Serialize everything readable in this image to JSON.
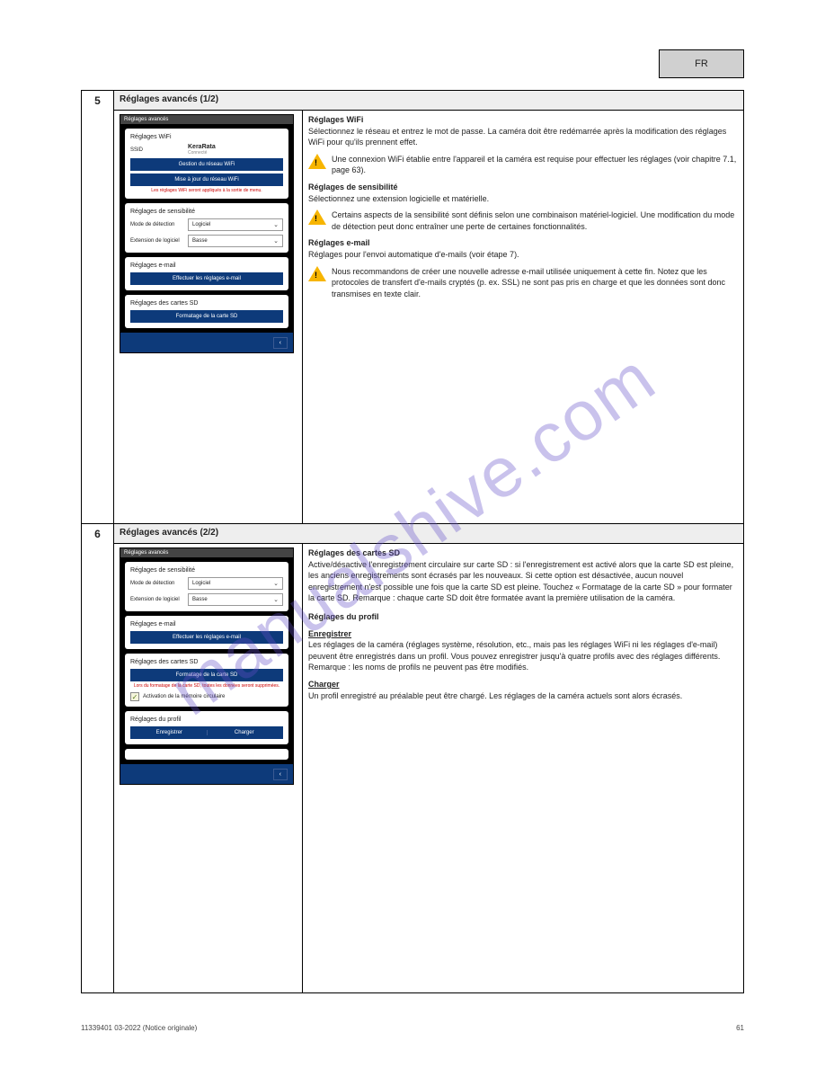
{
  "top_badge": "FR",
  "watermark": "manualshive.com",
  "step5": {
    "num": "5",
    "heading": "Réglages avancés (1/2)",
    "phone_header": "Réglages avancés",
    "wifi": {
      "title": "Réglages WiFi",
      "ssid_label": "SSID",
      "ssid_value": "KeraRata",
      "ssid_sub": "Connecté",
      "btn1": "Gestion du réseau WiFi",
      "btn2": "Mise à jour du réseau WiFi",
      "note": "Les réglages WiFi seront appliqués à la sortie de menu."
    },
    "sens": {
      "title": "Réglages de sensibilité",
      "row1_label": "Mode de détection",
      "row1_value": "Logiciel",
      "row2_label": "Extension de logiciel",
      "row2_value": "Basse"
    },
    "email": {
      "title": "Réglages e-mail",
      "btn": "Effectuer les réglages e-mail"
    },
    "sd": {
      "title": "Réglages des cartes SD",
      "btn": "Formatage de la carte SD"
    },
    "desc": {
      "p1_title": "Réglages WiFi",
      "p1": "Sélectionnez le réseau et entrez le mot de passe. La caméra doit être redémarrée après la modification des réglages WiFi pour qu'ils prennent effet.",
      "w1": "Une connexion WiFi établie entre l'appareil et la caméra est requise pour effectuer les réglages (voir chapitre 7.1, page 63).",
      "p2_title": "Réglages de sensibilité",
      "p2": "Sélectionnez une extension logicielle et matérielle.",
      "w2": "Certains aspects de la sensibilité sont définis selon une combinaison matériel-logiciel. Une modification du mode de détection peut donc entraîner une perte de certaines fonctionnalités.",
      "p3_title": "Réglages e-mail",
      "p3": "Réglages pour l'envoi automatique d'e-mails (voir étape 7).",
      "w3": "Nous recommandons de créer une nouvelle adresse e-mail utilisée uniquement à cette fin. Notez que les protocoles de transfert d'e-mails cryptés (p. ex. SSL) ne sont pas pris en charge et que les données sont donc transmises en texte clair."
    }
  },
  "step6": {
    "num": "6",
    "heading": "Réglages avancés (2/2)",
    "phone_header": "Réglages avancés",
    "sens": {
      "title": "Réglages de sensibilité",
      "row1_label": "Mode de détection",
      "row1_value": "Logiciel",
      "row2_label": "Extension de logiciel",
      "row2_value": "Basse"
    },
    "email": {
      "title": "Réglages e-mail",
      "btn": "Effectuer les réglages e-mail"
    },
    "sd": {
      "title": "Réglages des cartes SD",
      "btn": "Formatage de la carte SD",
      "note": "Lors du formatage de la carte SD, toutes les données seront supprimées.",
      "check": "Activation de la mémoire circulaire"
    },
    "profil": {
      "title": "Réglages du profil",
      "left": "Enregistrer",
      "right": "Charger"
    },
    "desc": {
      "p1_title": "Réglages des cartes SD",
      "p1": "Active/désactive l'enregistrement circulaire sur carte SD : si l'enregistrement est activé alors que la carte SD est pleine, les anciens enregistrements sont écrasés par les nouveaux. Si cette option est désactivée, aucun nouvel enregistrement n'est possible une fois que la carte SD est pleine. Touchez « Formatage de la carte SD » pour formater la carte SD. Remarque : chaque carte SD doit être formatée avant la première utilisation de la caméra.",
      "p2_title": "Enregistrer",
      "p2": "Les réglages de la caméra (réglages système, résolution, etc., mais pas les réglages WiFi ni les réglages d'e-mail) peuvent être enregistrés dans un profil. Vous pouvez enregistrer jusqu'à quatre profils avec des réglages différents. Remarque : les noms de profils ne peuvent pas être modifiés.",
      "p3_title": "Charger",
      "p3": "Un profil enregistré au préalable peut être chargé. Les réglages de la caméra actuels sont alors écrasés."
    }
  },
  "footer_left": "11339401   03-2022 (Notice originale)",
  "footer_right": "61"
}
